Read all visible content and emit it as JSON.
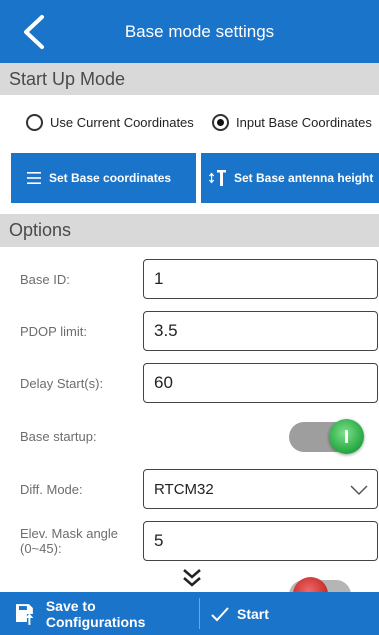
{
  "header": {
    "title": "Base mode settings"
  },
  "startup": {
    "section_title": "Start Up Mode",
    "option_current": "Use Current Coordinates",
    "option_input": "Input Base Coordinates",
    "selected": "input"
  },
  "actions": {
    "set_coords_label": "Set Base coordinates",
    "set_height_label": "Set Base antenna height"
  },
  "options": {
    "section_title": "Options",
    "base_id_label": "Base ID:",
    "base_id_value": "1",
    "pdop_label": "PDOP limit:",
    "pdop_value": "3.5",
    "delay_label": "Delay Start(s):",
    "delay_value": "60",
    "startup_label": "Base startup:",
    "startup_on": true,
    "diff_mode_label": "Diff. Mode:",
    "diff_mode_value": "RTCM32",
    "elev_label_line1": "Elev. Mask angle",
    "elev_label_line2": "(0~45):",
    "elev_value": "5"
  },
  "footer": {
    "save_label": "Save to Configurations",
    "start_label": "Start"
  },
  "colors": {
    "primary": "#1a74c9",
    "section_bg": "#d9d9d9",
    "toggle_on": "#22a640"
  }
}
